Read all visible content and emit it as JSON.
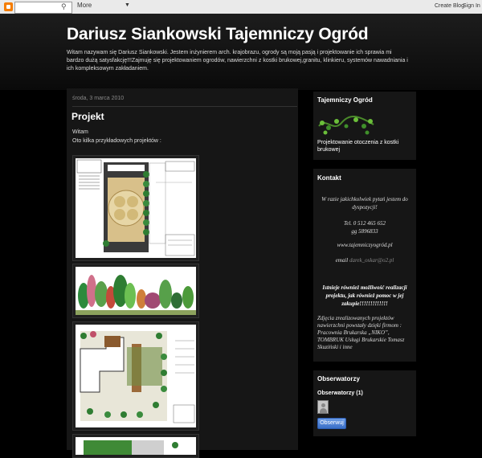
{
  "navbar": {
    "search_placeholder": "",
    "more_label": "More",
    "create_blog_label": "Create Blog",
    "sign_in_label": "Sign In"
  },
  "header": {
    "title": "Dariusz Siankowski Tajemniczy Ogród",
    "description": "Witam nazywam się Dariusz Siankowski. Jestem inżynierem arch. krajobrazu, ogrody są moją pasją i projektowanie ich sprawia mi bardzo dużą satysfakcję!!!Zajmuję się projektowaniem ogrodów, nawierzchni z kostki brukowej,granitu, klinkieru, systemów nawadniania i ich kompleksowym zakładaniem."
  },
  "post": {
    "date": "środa, 3 marca 2010",
    "title": "Projekt",
    "line1": "Witam",
    "line2": "Oto kilka przykładowych projektów :"
  },
  "sidebar": {
    "garden_widget": {
      "title": "Tajemniczy Ogród",
      "caption": "Projektowanie otoczenia z kostki brukowej"
    },
    "contact": {
      "title": "Kontakt",
      "line1": "W razie jakichkolwiek pytań jestem do dyspozycji!",
      "phone": "Tel. 0 512 465 652",
      "gg": "gg 5896833",
      "website": "www.tajemniczyogród.pl",
      "email_label": "email",
      "email_value": "darek_oskar@o2.pl",
      "projects_line": "Istnieje również możliwość realizacji projektu, jak również pomoc w jej zakupie!!!!!!!!!!!!!",
      "photos_text": "Zdjęcia zrealizowanych projektów nawierzchni powstały dzięki firmom : Pracownia Brukarska „NIKO”, TOMBRUK Usługi Brukarskie Tomasz Skuziński i inne"
    },
    "followers": {
      "title": "Obserwatorzy",
      "count_label": "Obserwatorzy (1)",
      "follow_button": "Obserwuj"
    }
  },
  "colors": {
    "page_bg": "#000000",
    "panel_bg": "#161616",
    "follow_button": "#3a6fc7",
    "link": "#888888"
  }
}
